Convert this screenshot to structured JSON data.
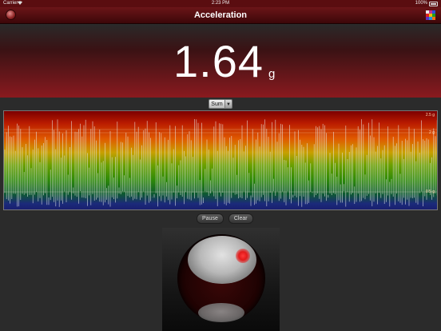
{
  "status_bar": {
    "carrier": "Carrier",
    "wifi_icon": "wifi-icon",
    "time": "2:23 PM",
    "battery": "100%",
    "battery_icon": "battery-icon"
  },
  "nav": {
    "title": "Acceleration",
    "left_icon": "record-button-icon",
    "right_icon": "color-palette-icon"
  },
  "readout": {
    "value": "1.64",
    "unit": "g"
  },
  "mode_select": {
    "selected": "Sum"
  },
  "graph": {
    "labels": [
      "2.5 g",
      "2 g",
      "0.5 g"
    ]
  },
  "buttons": {
    "pause": "Pause",
    "clear": "Clear"
  },
  "colors": {
    "nav_bar": "#5a0d10",
    "accent_red": "#e21a1a",
    "background": "#2b2b2b"
  }
}
